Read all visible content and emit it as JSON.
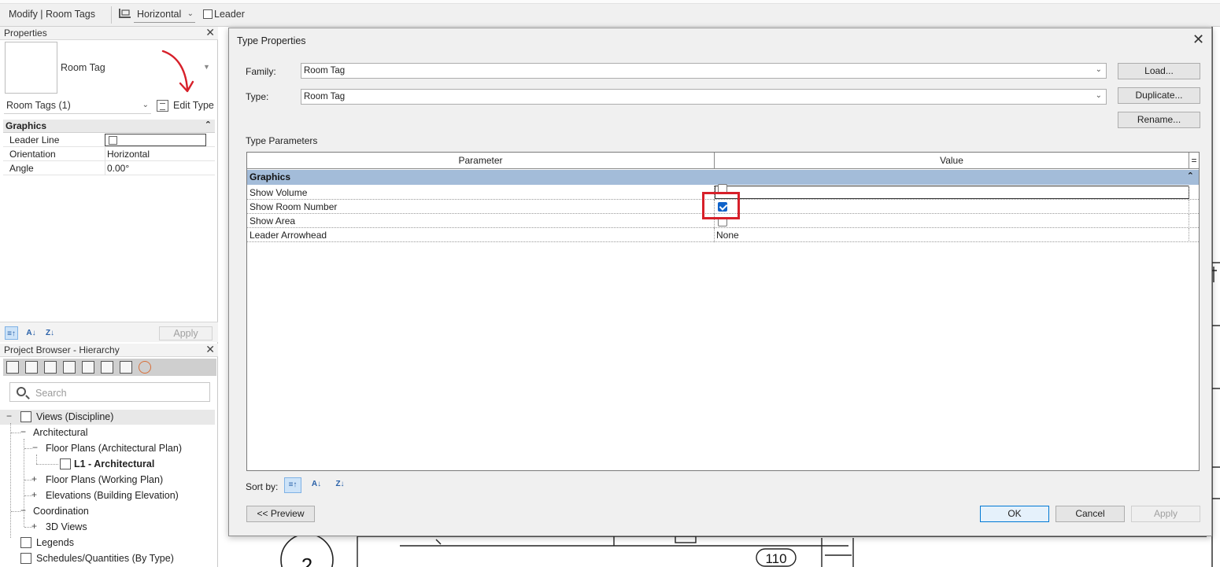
{
  "optionsbar": {
    "context": "Modify | Room Tags",
    "orientation": "Horizontal",
    "leader_label": "Leader"
  },
  "properties": {
    "title": "Properties",
    "type_name": "Room Tag",
    "selection": "Room Tags (1)",
    "edit_type_label": "Edit Type",
    "section": "Graphics",
    "rows": [
      {
        "key": "Leader Line",
        "value": ""
      },
      {
        "key": "Orientation",
        "value": "Horizontal"
      },
      {
        "key": "Angle",
        "value": "0.00°"
      }
    ],
    "apply_label": "Apply"
  },
  "project_browser": {
    "title": "Project Browser - Hierarchy",
    "search_placeholder": "Search",
    "tree": [
      {
        "label": "Views (Discipline)"
      },
      {
        "label": "Architectural"
      },
      {
        "label": "Floor Plans (Architectural Plan)"
      },
      {
        "label": "L1 - Architectural"
      },
      {
        "label": "Floor Plans (Working Plan)"
      },
      {
        "label": "Elevations (Building Elevation)"
      },
      {
        "label": "Coordination"
      },
      {
        "label": "3D Views"
      },
      {
        "label": "Legends"
      },
      {
        "label": "Schedules/Quantities (By Type)"
      }
    ]
  },
  "dialog": {
    "title": "Type Properties",
    "family_label": "Family:",
    "family_value": "Room Tag",
    "type_label": "Type:",
    "type_value": "Room Tag",
    "load_label": "Load...",
    "duplicate_label": "Duplicate...",
    "rename_label": "Rename...",
    "type_parameters_label": "Type Parameters",
    "col_parameter": "Parameter",
    "col_value": "Value",
    "col_menu": "=",
    "section": "Graphics",
    "rows": [
      {
        "param": "Show Volume",
        "value": "",
        "checked": false
      },
      {
        "param": "Show Room Number",
        "value": "",
        "checked": true
      },
      {
        "param": "Show Area",
        "value": "",
        "checked": false
      },
      {
        "param": "Leader Arrowhead",
        "value": "None"
      }
    ],
    "sort_by_label": "Sort by:",
    "preview_label": "<< Preview",
    "ok_label": "OK",
    "cancel_label": "Cancel",
    "apply_label": "Apply"
  },
  "drawing": {
    "tag_number": "110",
    "level_label": "2"
  },
  "colors": {
    "highlight": "#d7202a",
    "section_band": "#a3bcd9",
    "checkbox_on": "#0f62c9",
    "annotation_arrow": "#d7202a"
  }
}
